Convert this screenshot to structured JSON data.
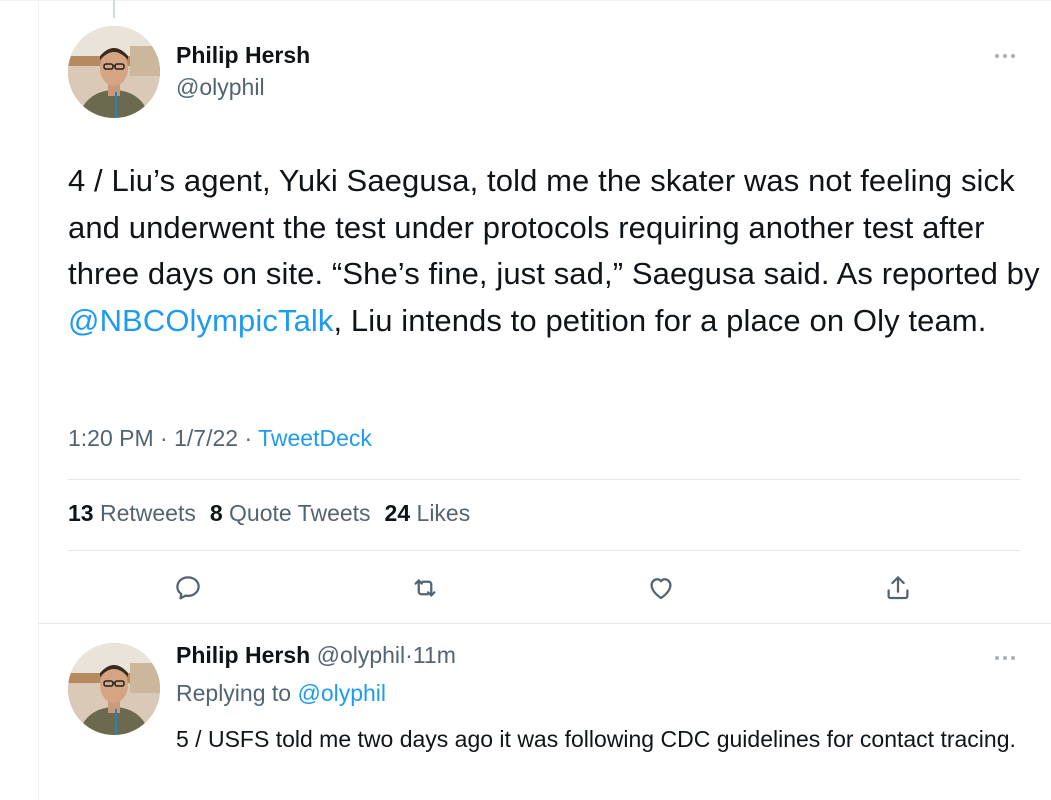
{
  "tweet": {
    "author_name": "Philip Hersh",
    "author_handle": "@olyphil",
    "text_part1": "4 / Liu’s agent, Yuki Saegusa, told me the skater was not feeling sick and underwent the test under protocols requiring another test after three days on site.  “She’s fine, just sad,” Saegusa said.  As reported by ",
    "mention": "@NBCOlympicTalk",
    "text_part2": ", Liu intends to petition for a place on Oly team.",
    "time": "1:20 PM",
    "date": "1/7/22",
    "separator": "·",
    "source": "TweetDeck",
    "stats": {
      "retweets_count": "13",
      "retweets_label": "Retweets",
      "quotes_count": "8",
      "quotes_label": "Quote Tweets",
      "likes_count": "24",
      "likes_label": "Likes"
    },
    "actions": [
      "reply-icon",
      "retweet-icon",
      "like-icon",
      "share-icon"
    ]
  },
  "reply": {
    "author_name": "Philip Hersh",
    "author_handle": "@olyphil",
    "age": "11m",
    "separator": "·",
    "replying_to_label": "Replying to",
    "replying_to_handle": "@olyphil",
    "text": "5 / USFS told me two days ago it was following CDC guidelines for contact tracing."
  },
  "colors": {
    "accent": "#1d9bf0",
    "text": "#0f1419",
    "secondary": "#536471"
  }
}
